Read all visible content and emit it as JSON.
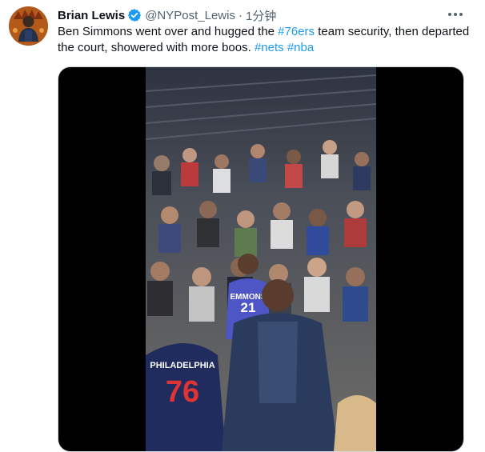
{
  "tweet": {
    "display_name": "Brian Lewis",
    "verified_icon": "verified-badge-icon",
    "handle": "@NYPost_Lewis",
    "separator": "·",
    "time": "1分钟",
    "more_icon": "more-horizontal-icon",
    "text": {
      "part1": "Ben Simmons went over and hugged the ",
      "tag1": "#76ers",
      "part2": " team security, then departed the court, showered with more boos. ",
      "tag2": "#nets",
      "space": " ",
      "tag3": "#nba"
    },
    "media": {
      "type": "video",
      "jersey_text_1": "EMMONS",
      "jersey_number_1": "21",
      "jersey_text_2": "PHILADELPHIA",
      "jersey_number_2": "76"
    }
  },
  "colors": {
    "link": "#1d9bf0",
    "verified": "#1d9bf0",
    "secondary_text": "#536471",
    "primary_text": "#0f1419",
    "media_background": "#000000"
  }
}
